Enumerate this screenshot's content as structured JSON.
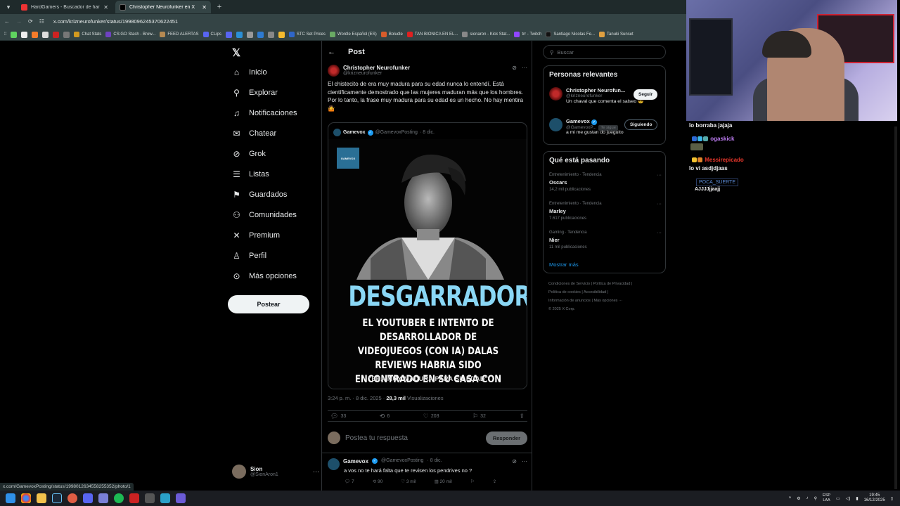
{
  "browser": {
    "tabs": [
      {
        "title": "HardGamers - Buscador de har",
        "active": false
      },
      {
        "title": "Christopher Neurofunker en X",
        "active": true
      }
    ],
    "url": "x.com/krizneurofunker/status/1998096245370622451",
    "bookmarks": [
      "Chat Stats",
      "CS:GO Stash - Brow...",
      "FEED ALERTAS",
      "CLips",
      "STC Set Prices",
      "Wordle Español (ES)",
      "Boludle",
      "TAN BIONICA EN EL...",
      "sionaron - Kick Stat...",
      "trr - Twitch",
      "Santiago Nicolas Fe...",
      "Tanuki Sunset"
    ],
    "status_url": "x.com/GamevoxPosting/status/1998012634558255352/photo/1"
  },
  "nav": {
    "items": [
      "Inicio",
      "Explorar",
      "Notificaciones",
      "Chatear",
      "Grok",
      "Listas",
      "Guardados",
      "Comunidades",
      "Premium",
      "Perfil",
      "Más opciones"
    ],
    "post_button": "Postear",
    "account": {
      "name": "Sion",
      "handle": "@SionAron1"
    }
  },
  "main": {
    "header": "Post",
    "post": {
      "name": "Christopher Neurofunker",
      "handle": "@krizneurofunker",
      "text": "El chistecito de era muy madura para su edad nunca lo entendí. Está científicamente demostrado que las mujeres maduran más que los hombres. Por lo tanto, la frase muy madura para su edad es un hecho. No hay mentira 🤷",
      "quote": {
        "name": "Gamevox",
        "handle": "@GamevoxPosting",
        "date": "· 8 dic.",
        "logo_text": "GAMEVOX",
        "headline": "DESGARRADOR",
        "subline": "EL YOUTUBER E INTENTO DE DESARROLLADOR DE VIDEOJUEGOS (CON IA) DALAS REVIEWS HABRIA SIDO ENCONTRADO EN SU CASA CON VIDA",
        "quote_line": "\"ERA MUY MADURA PARA SU EDAD\""
      },
      "time": "3:24 p. m. · 8 dic. 2025 ·",
      "views": "28,3 mil",
      "views_label": "Visualizaciones",
      "stats": {
        "replies": "33",
        "reposts": "6",
        "likes": "203",
        "bookmarks": "32"
      }
    },
    "reply_box": {
      "placeholder": "Postea tu respuesta",
      "button": "Responder"
    },
    "reply": {
      "name": "Gamevox",
      "handle": "@GamevoxPosting",
      "date": "· 8 dic.",
      "text": "a vos no te hará falta que te revisen los pendrives no ?",
      "stats": {
        "replies": "7",
        "reposts": "90",
        "likes": "3 mil",
        "views": "20 mil"
      }
    }
  },
  "right": {
    "search_placeholder": "Buscar",
    "relevant": {
      "title": "Personas relevantes",
      "people": [
        {
          "name": "Christopher Neurofun...",
          "handle": "@krizneurofunker",
          "bio": "Un chaval que comenta el salseo 😎",
          "button": "Seguir"
        },
        {
          "name": "Gamevox",
          "handle": "@GamevoxP...",
          "follows_you": "Te sigue",
          "bio": "a mi me gustan do jueguito",
          "button": "Siguiendo"
        }
      ]
    },
    "trends": {
      "title": "Qué está pasando",
      "items": [
        {
          "category": "Entretenimiento · Tendencia",
          "title": "Oscars",
          "count": "14,2 mil publicaciones"
        },
        {
          "category": "Entretenimiento · Tendencia",
          "title": "Marley",
          "count": "7.617 publicaciones"
        },
        {
          "category": "Gaming · Tendencia",
          "title": "Nier",
          "count": "11 mil publicaciones"
        }
      ],
      "show_more": "Mostrar más"
    },
    "footer": [
      "Condiciones de Servicio",
      "Política de Privacidad",
      "Política de cookies",
      "Accesibilidad",
      "Información de anuncios",
      "Más opciones ···",
      "© 2025 X Corp."
    ]
  },
  "chat": {
    "messages": [
      {
        "user": "",
        "text": "lo borraba jajaja"
      },
      {
        "user": "ogaskick",
        "text": "",
        "color": "#bd7cf2"
      },
      {
        "user": "Messirepicado",
        "text": "",
        "color": "#e8372b"
      },
      {
        "user": "",
        "text": "lo vi asdjdjaas"
      },
      {
        "user": "POCA_SUERTE",
        "text": "",
        "color": "#5b8bd6"
      },
      {
        "user": "",
        "text": "AJJJJjjaajj"
      }
    ]
  },
  "taskbar": {
    "language": "ESP",
    "layout": "LAA",
    "time": "19:45",
    "date": "16/12/2025"
  }
}
